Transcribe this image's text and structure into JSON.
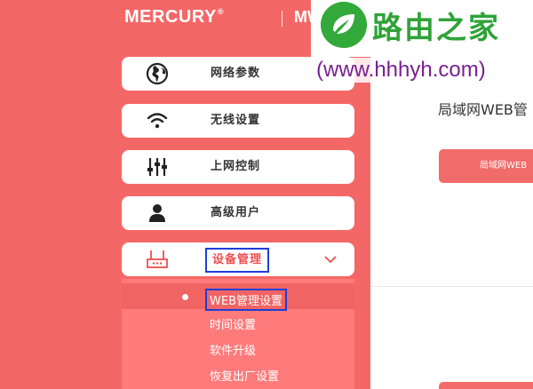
{
  "header": {
    "brand": "MERCURY",
    "registered_mark": "®",
    "model": "MW"
  },
  "menu": {
    "items": [
      {
        "label": "网络参数",
        "icon": "globe-icon"
      },
      {
        "label": "无线设置",
        "icon": "wifi-icon"
      },
      {
        "label": "上网控制",
        "icon": "sliders-icon"
      },
      {
        "label": "高级用户",
        "icon": "user-icon"
      },
      {
        "label": "设备管理",
        "icon": "router-icon",
        "expanded": true
      }
    ],
    "expand_icon": "chevron-down-icon"
  },
  "submenu": {
    "items": [
      {
        "label": "WEB管理设置",
        "selected": true
      },
      {
        "label": "时间设置"
      },
      {
        "label": "软件升级"
      },
      {
        "label": "恢复出厂设置"
      }
    ]
  },
  "content": {
    "title": "局域网WEB管",
    "button_label": "局域网WEB"
  },
  "watermark": {
    "brand": "路由之家",
    "url": "(www.hhhyh.com)",
    "icon": "leaf-logo-icon"
  },
  "colors": {
    "sidebar_bg": "#f46767",
    "accent": "#f04f4f",
    "highlight_border": "#1d3fd8",
    "watermark_green": "#2ea338",
    "watermark_purple": "#7a1f91"
  }
}
